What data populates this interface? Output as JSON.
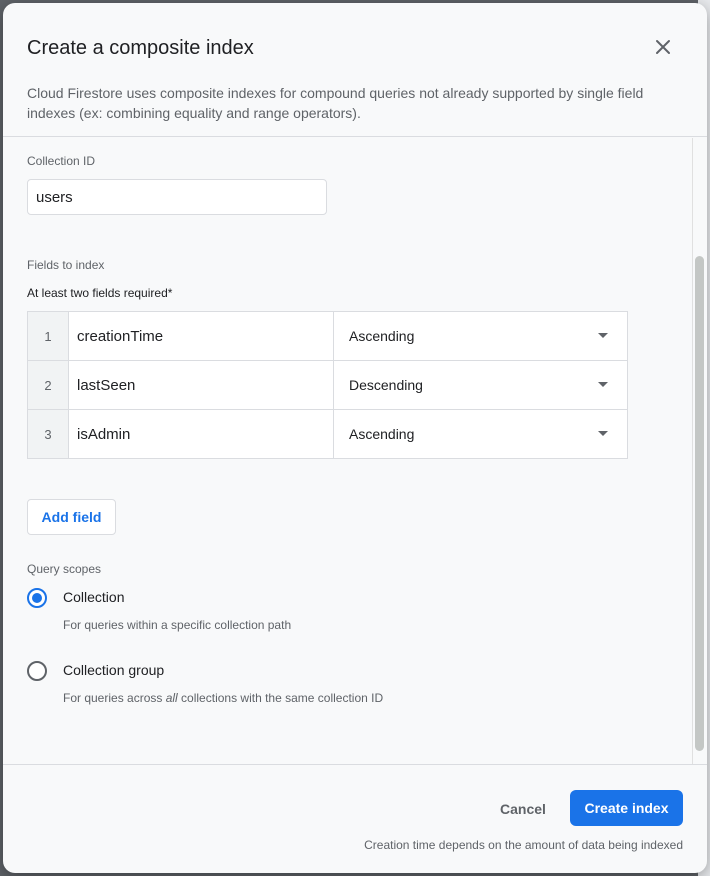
{
  "dialog": {
    "title": "Create a composite index",
    "description": "Cloud Firestore uses composite indexes for compound queries not already supported by single field indexes (ex: combining equality and range operators)."
  },
  "collection": {
    "label": "Collection ID",
    "value": "users"
  },
  "fields": {
    "label": "Fields to index",
    "required_note": "At least two fields required*",
    "rows": [
      {
        "num": "1",
        "name": "creationTime",
        "order": "Ascending"
      },
      {
        "num": "2",
        "name": "lastSeen",
        "order": "Descending"
      },
      {
        "num": "3",
        "name": "isAdmin",
        "order": "Ascending"
      }
    ],
    "add_label": "Add field"
  },
  "query_scopes": {
    "label": "Query scopes",
    "options": [
      {
        "label": "Collection",
        "desc_before": "For queries within a specific collection path",
        "desc_em": "",
        "desc_after": "",
        "selected": true
      },
      {
        "label": "Collection group",
        "desc_before": "For queries across ",
        "desc_em": "all",
        "desc_after": " collections with the same collection ID",
        "selected": false
      }
    ]
  },
  "footer": {
    "cancel_label": "Cancel",
    "create_label": "Create index",
    "note": "Creation time depends on the amount of data being indexed"
  },
  "colors": {
    "accent": "#1a73e8",
    "text": "#202124",
    "muted": "#5f6368",
    "border": "#dadce0"
  },
  "icons": {
    "close": "close-icon",
    "dropdown": "caret-down-icon"
  }
}
